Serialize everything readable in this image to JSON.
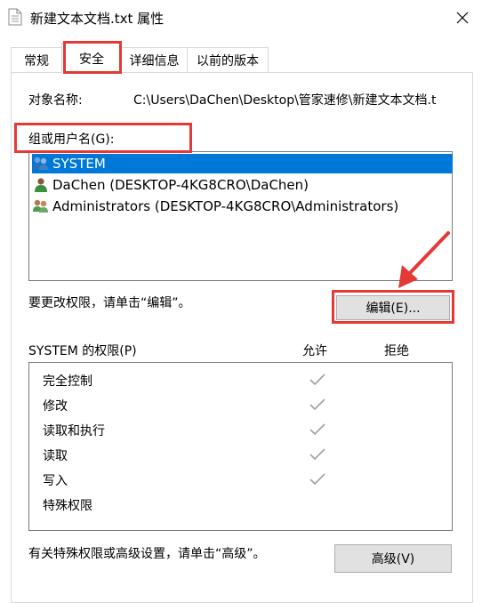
{
  "window": {
    "title": "新建文本文档.txt 属性",
    "close_icon": "close-icon"
  },
  "tabs": [
    {
      "label": "常规"
    },
    {
      "label": "安全"
    },
    {
      "label": "详细信息"
    },
    {
      "label": "以前的版本"
    }
  ],
  "active_tab": "安全",
  "object": {
    "label": "对象名称:",
    "value": "C:\\Users\\DaChen\\Desktop\\管家速修\\新建文本文档.t"
  },
  "groups": {
    "label": "组或用户名(G):",
    "items": [
      {
        "name": "SYSTEM",
        "icon": "user-group-icon",
        "selected": true
      },
      {
        "name": "DaChen (DESKTOP-4KG8CRO\\DaChen)",
        "icon": "user-icon",
        "selected": false
      },
      {
        "name": "Administrators (DESKTOP-4KG8CRO\\Administrators)",
        "icon": "user-group-icon",
        "selected": false
      }
    ]
  },
  "edit": {
    "hint": "要更改权限，请单击“编辑”。",
    "button_label": "编辑(E)..."
  },
  "permissions": {
    "label": "SYSTEM 的权限(P)",
    "allow_header": "允许",
    "deny_header": "拒绝",
    "items": [
      {
        "name": "完全控制",
        "allow": true,
        "deny": false
      },
      {
        "name": "修改",
        "allow": true,
        "deny": false
      },
      {
        "name": "读取和执行",
        "allow": true,
        "deny": false
      },
      {
        "name": "读取",
        "allow": true,
        "deny": false
      },
      {
        "name": "写入",
        "allow": true,
        "deny": false
      },
      {
        "name": "特殊权限",
        "allow": false,
        "deny": false
      }
    ]
  },
  "advanced": {
    "hint": "有关特殊权限或高级设置，请单击“高级”。",
    "button_label": "高级(V)"
  },
  "colors": {
    "selection": "#0078d7",
    "highlight": "#e53935",
    "check": "#a0a0a0"
  }
}
